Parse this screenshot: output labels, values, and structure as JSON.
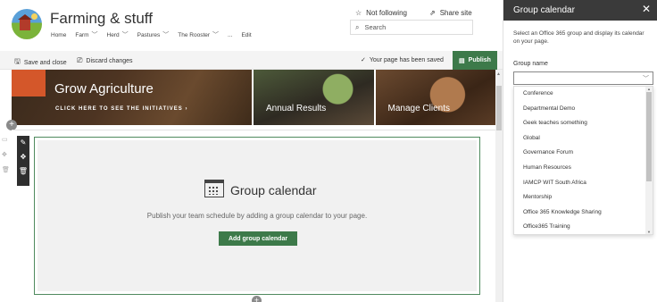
{
  "site": {
    "title": "Farming & stuff",
    "nav": [
      {
        "label": "Home",
        "has_menu": false
      },
      {
        "label": "Farm",
        "has_menu": true
      },
      {
        "label": "Herd",
        "has_menu": true
      },
      {
        "label": "Pastures",
        "has_menu": true
      },
      {
        "label": "The Rooster",
        "has_menu": true
      },
      {
        "label": "...",
        "has_menu": false
      },
      {
        "label": "Edit",
        "has_menu": false
      }
    ],
    "follow_label": "Not following",
    "share_label": "Share site",
    "search_placeholder": "Search"
  },
  "commandbar": {
    "save_close": "Save and close",
    "discard": "Discard changes",
    "status": "Your page has been saved",
    "publish": "Publish"
  },
  "hero": {
    "main_title": "Grow Agriculture",
    "main_link": "CLICK HERE TO SEE THE INITIATIVES",
    "tile2": "Annual Results",
    "tile3": "Manage Clients",
    "accent_color": "#d4572a"
  },
  "webpart": {
    "title": "Group calendar",
    "description": "Publish your team schedule by adding a group calendar to your page.",
    "button": "Add group calendar"
  },
  "panel": {
    "title": "Group calendar",
    "description": "Select an Office 365 group and display its calendar on your page.",
    "field_label": "Group name",
    "selected_value": "",
    "options": [
      "Conference",
      "Departmental Demo",
      "Geek teaches something",
      "Global",
      "Governance Forum",
      "Human Resources",
      "IAMCP WIT South Africa",
      "Mentorship",
      "Office 365 Knowledge Sharing",
      "Office365 Training"
    ]
  },
  "colors": {
    "primary_green": "#3d7a4a",
    "panel_header": "#3a3a3a"
  },
  "icons": {
    "star": "star-icon",
    "share": "share-icon",
    "search": "search-icon",
    "save": "save-icon",
    "discard": "discard-icon",
    "check": "check-icon",
    "publish": "publish-icon",
    "calendar": "calendar-icon",
    "close": "close-icon",
    "chevron": "chevron-down-icon"
  }
}
